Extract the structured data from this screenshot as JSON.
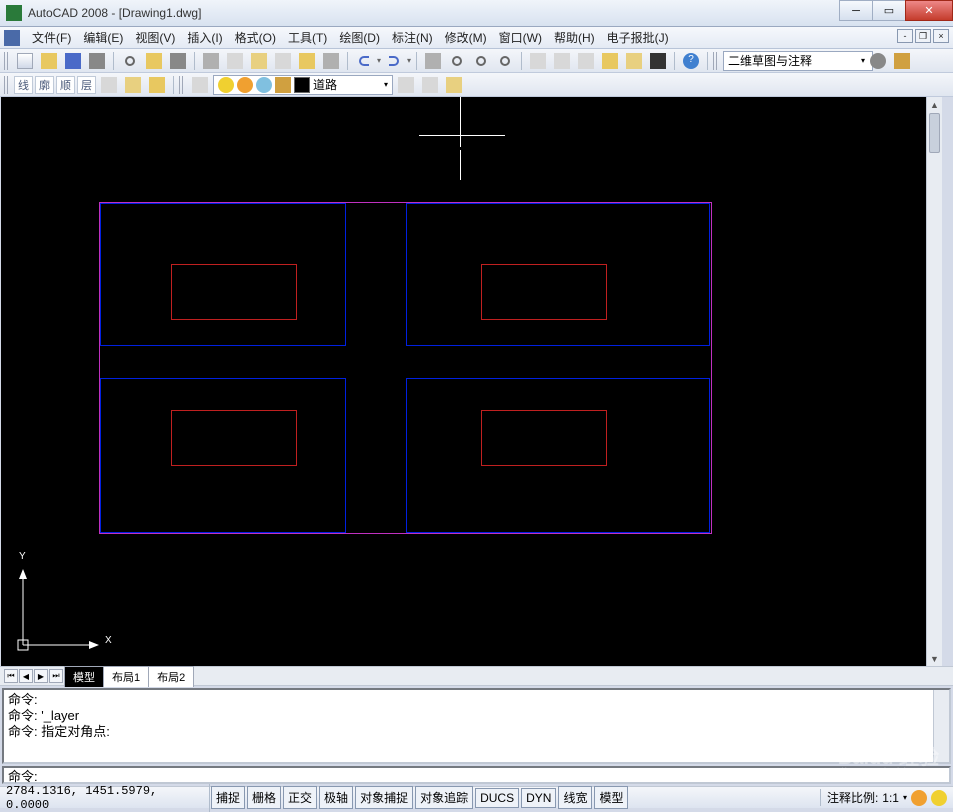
{
  "app": {
    "title": "AutoCAD 2008 - [Drawing1.dwg]"
  },
  "menu": {
    "items": [
      "文件(F)",
      "编辑(E)",
      "视图(V)",
      "插入(I)",
      "格式(O)",
      "工具(T)",
      "绘图(D)",
      "标注(N)",
      "修改(M)",
      "窗口(W)",
      "帮助(H)",
      "电子报批(J)"
    ]
  },
  "workspace": {
    "selected": "二维草图与注释"
  },
  "toolbar2": {
    "text_buttons": [
      "线",
      "廓",
      "顺",
      "层"
    ]
  },
  "layer": {
    "current": "道路"
  },
  "tabs": {
    "items": [
      "模型",
      "布局1",
      "布局2"
    ],
    "active": 0
  },
  "command": {
    "history": [
      "命令:",
      "命令: '_layer",
      "命令: 指定对角点:"
    ],
    "prompt": "命令:"
  },
  "status": {
    "coords": "2784.1316, 1451.5979, 0.0000",
    "toggles": [
      "捕捉",
      "栅格",
      "正交",
      "极轴",
      "对象捕捉",
      "对象追踪",
      "DUCS",
      "DYN",
      "线宽",
      "模型"
    ],
    "anno_label": "注释比例:",
    "anno_value": "1:1"
  },
  "ucs": {
    "x_label": "X",
    "y_label": "Y"
  },
  "watermark": {
    "brand": "Baidu 经验",
    "url": "jingyan.baidu.com"
  }
}
